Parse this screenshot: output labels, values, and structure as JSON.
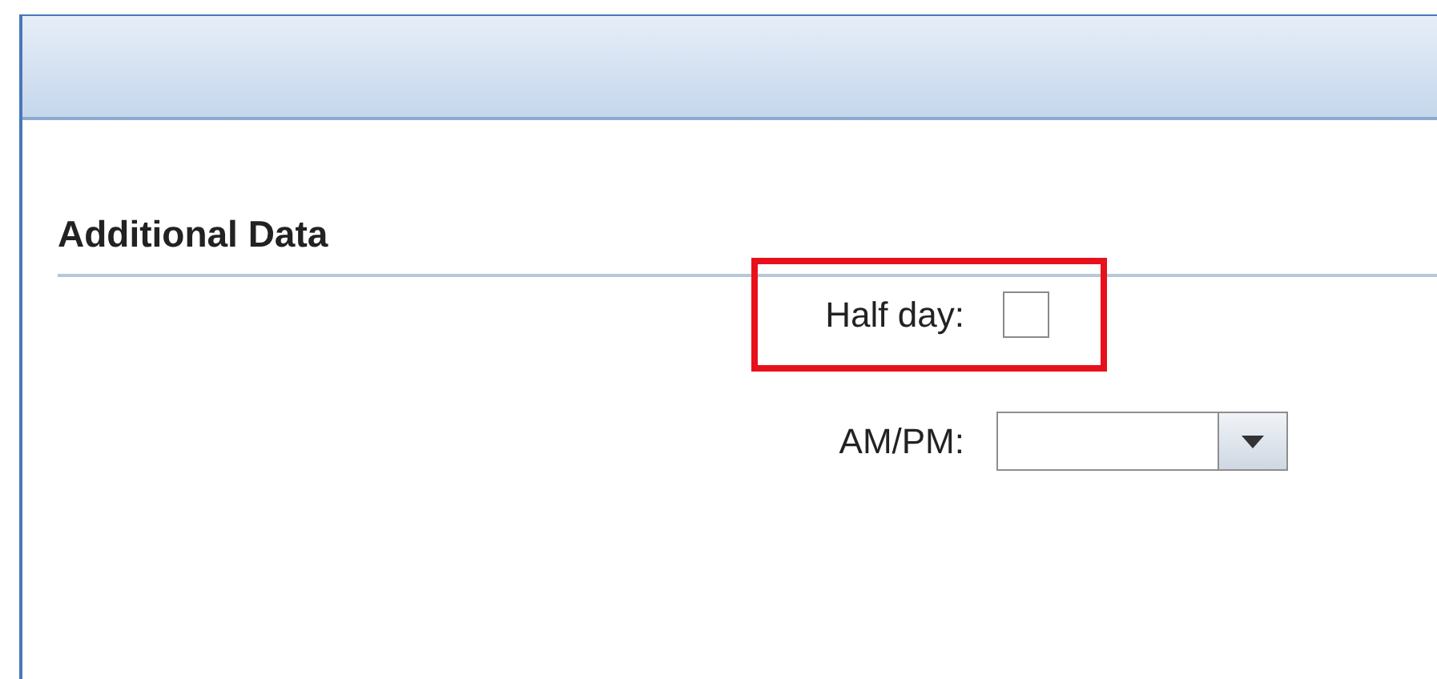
{
  "section": {
    "title": "Additional Data"
  },
  "fields": [
    {
      "kind": "checkbox",
      "label": "Half day:",
      "checked": false,
      "highlighted": true
    },
    {
      "kind": "dropdown",
      "label": "AM/PM:"
    }
  ]
}
